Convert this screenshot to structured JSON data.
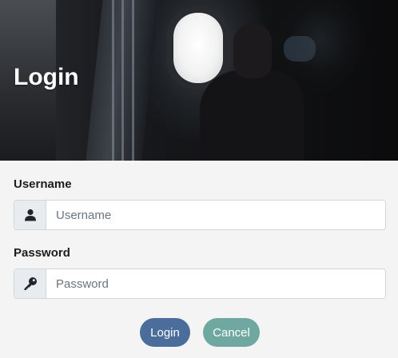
{
  "header": {
    "title": "Login"
  },
  "form": {
    "username": {
      "label": "Username",
      "placeholder": "Username",
      "value": "",
      "icon": "user-icon"
    },
    "password": {
      "label": "Password",
      "placeholder": "Password",
      "value": "",
      "icon": "key-icon"
    }
  },
  "actions": {
    "login_label": "Login",
    "cancel_label": "Cancel"
  },
  "colors": {
    "login_button": "#4a6d9c",
    "cancel_button": "#6ea8a0",
    "background": "#f4f4f4"
  }
}
